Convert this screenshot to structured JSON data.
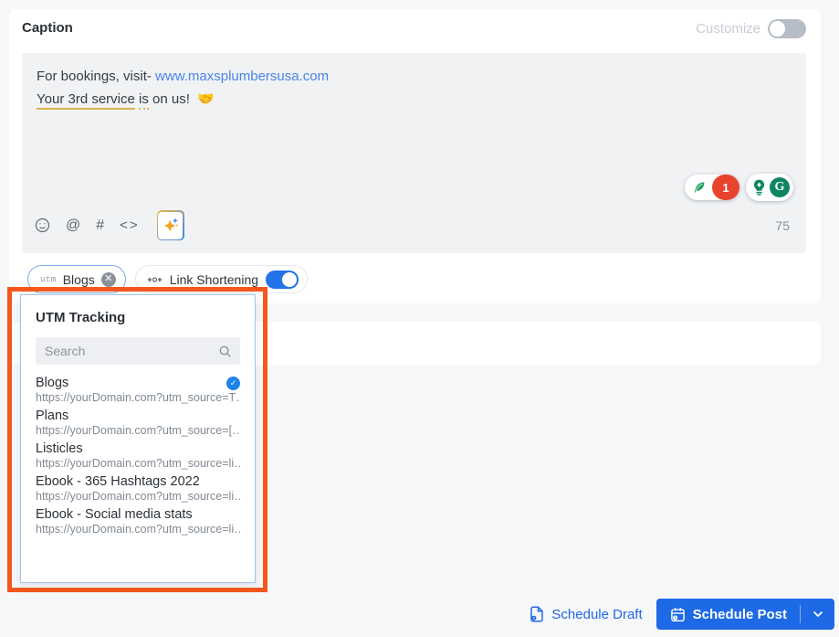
{
  "caption": {
    "title": "Caption",
    "customize_label": "Customize",
    "text_line1": "For bookings, visit- ",
    "link": "www.maxsplumbersusa.com",
    "line2_underlined": "Your 3rd service",
    "line2_dotted": "is",
    "line2_rest": "on us!",
    "emoji": "🤝",
    "char_count": "75",
    "grammarly_alert_count": "1",
    "grammarly_logo": "G"
  },
  "toolbar": {
    "mention_glyph": "@",
    "hashtag_glyph": "#",
    "code_glyph": "<>"
  },
  "chips": {
    "utm_prefix": "utm",
    "utm_label": "Blogs",
    "link_shortening_label": "Link Shortening"
  },
  "utm_dropdown": {
    "title": "UTM Tracking",
    "search_placeholder": "Search",
    "items": [
      {
        "name": "Blogs",
        "url": "https://yourDomain.com?utm_source=T…",
        "selected": true
      },
      {
        "name": "Plans",
        "url": "https://yourDomain.com?utm_source=[…",
        "selected": false
      },
      {
        "name": "Listicles",
        "url": "https://yourDomain.com?utm_source=li…",
        "selected": false
      },
      {
        "name": "Ebook - 365 Hashtags 2022",
        "url": "https://yourDomain.com?utm_source=li…",
        "selected": false
      },
      {
        "name": "Ebook - Social media stats",
        "url": "https://yourDomain.com?utm_source=li…",
        "selected": false
      }
    ]
  },
  "footer": {
    "schedule_draft": "Schedule Draft",
    "schedule_post": "Schedule Post"
  },
  "colors": {
    "accent_blue": "#1d69e6",
    "link_blue": "#4a84e8",
    "annotation_orange": "#f4571d",
    "toggle_on_blue": "#2273e8",
    "grammarly_green": "#0e8662",
    "alert_red": "#e8432d",
    "underline_gold": "#ddb24c"
  }
}
